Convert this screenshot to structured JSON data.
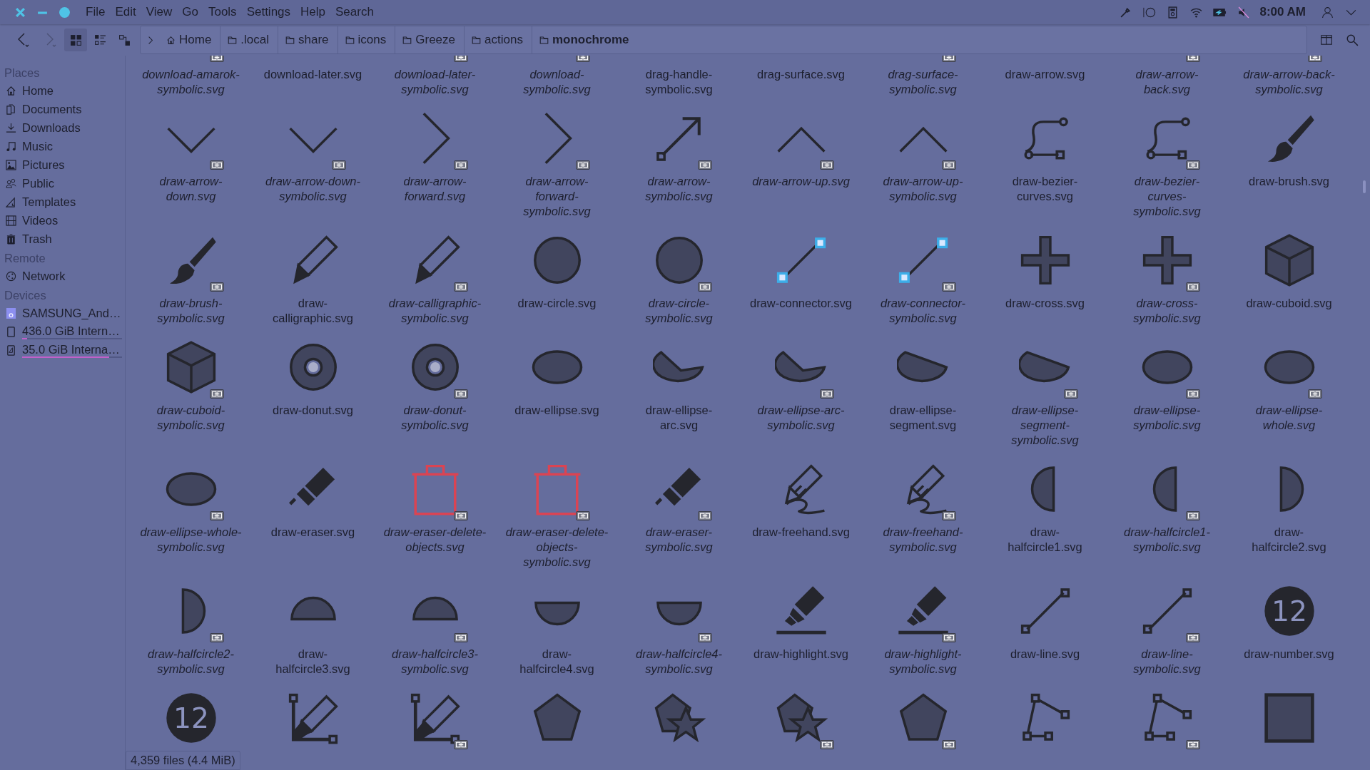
{
  "menu": [
    "File",
    "Edit",
    "View",
    "Go",
    "Tools",
    "Settings",
    "Help",
    "Search"
  ],
  "tray": {
    "clock": "8:00 AM",
    "muted": true
  },
  "navigation": [
    {
      "kind": "back",
      "disabled": false
    },
    {
      "kind": "forward",
      "disabled": true
    }
  ],
  "view_modes": [
    {
      "kind": "icons",
      "selected": true
    },
    {
      "kind": "compact",
      "selected": false
    },
    {
      "kind": "details",
      "selected": false
    }
  ],
  "breadcrumb": [
    {
      "label": "Home",
      "kind": "home",
      "current": false
    },
    {
      "label": ".local",
      "kind": "folder",
      "current": false
    },
    {
      "label": "share",
      "kind": "folder",
      "current": false
    },
    {
      "label": "icons",
      "kind": "folder",
      "current": false
    },
    {
      "label": "Greeze",
      "kind": "folder",
      "current": false
    },
    {
      "label": "actions",
      "kind": "folder",
      "current": false
    },
    {
      "label": "monochrome",
      "kind": "folder",
      "current": true
    }
  ],
  "sidebar": [
    {
      "title": "Places",
      "items": [
        {
          "label": "Home"
        },
        {
          "label": "Documents"
        },
        {
          "label": "Downloads"
        },
        {
          "label": "Music"
        },
        {
          "label": "Pictures"
        },
        {
          "label": "Public"
        },
        {
          "label": "Templates"
        },
        {
          "label": "Videos"
        },
        {
          "label": "Trash"
        }
      ]
    },
    {
      "title": "Remote",
      "items": [
        {
          "label": "Network"
        }
      ]
    },
    {
      "title": "Devices",
      "items": [
        {
          "label": "SAMSUNG_And…"
        },
        {
          "label": "436.0 GiB Intern…",
          "level": 0.05
        },
        {
          "label": "35.0 GiB Interna…",
          "level": 0.87
        }
      ]
    }
  ],
  "files": [
    {
      "label": "download-amarok-symbolic.svg",
      "link": true
    },
    {
      "label": "download-later.svg",
      "link": false
    },
    {
      "label": "download-later-symbolic.svg",
      "link": true
    },
    {
      "label": "download-symbolic.svg",
      "link": true
    },
    {
      "label": "drag-handle-symbolic.svg",
      "link": false
    },
    {
      "label": "drag-surface.svg",
      "link": false
    },
    {
      "label": "drag-surface-symbolic.svg",
      "link": true
    },
    {
      "label": "draw-arrow.svg",
      "link": false
    },
    {
      "label": "draw-arrow-back.svg",
      "link": true
    },
    {
      "label": "draw-arrow-back-symbolic.svg",
      "link": true
    },
    {
      "label": "draw-arrow-down.svg",
      "link": true
    },
    {
      "label": "draw-arrow-down-symbolic.svg",
      "link": true
    },
    {
      "label": "draw-arrow-forward.svg",
      "link": true
    },
    {
      "label": "draw-arrow-forward-symbolic.svg",
      "link": true
    },
    {
      "label": "draw-arrow-symbolic.svg",
      "link": true
    },
    {
      "label": "draw-arrow-up.svg",
      "link": true
    },
    {
      "label": "draw-arrow-up-symbolic.svg",
      "link": true
    },
    {
      "label": "draw-bezier-curves.svg",
      "link": false
    },
    {
      "label": "draw-bezier-curves-symbolic.svg",
      "link": true
    },
    {
      "label": "draw-brush.svg",
      "link": false
    },
    {
      "label": "draw-brush-symbolic.svg",
      "link": true
    },
    {
      "label": "draw-calligraphic.svg",
      "link": false
    },
    {
      "label": "draw-calligraphic-symbolic.svg",
      "link": true
    },
    {
      "label": "draw-circle.svg",
      "link": false
    },
    {
      "label": "draw-circle-symbolic.svg",
      "link": true
    },
    {
      "label": "draw-connector.svg",
      "link": false
    },
    {
      "label": "draw-connector-symbolic.svg",
      "link": true
    },
    {
      "label": "draw-cross.svg",
      "link": false
    },
    {
      "label": "draw-cross-symbolic.svg",
      "link": true
    },
    {
      "label": "draw-cuboid.svg",
      "link": false
    },
    {
      "label": "draw-cuboid-symbolic.svg",
      "link": true
    },
    {
      "label": "draw-donut.svg",
      "link": false
    },
    {
      "label": "draw-donut-symbolic.svg",
      "link": true
    },
    {
      "label": "draw-ellipse.svg",
      "link": false
    },
    {
      "label": "draw-ellipse-arc.svg",
      "link": false
    },
    {
      "label": "draw-ellipse-arc-symbolic.svg",
      "link": true
    },
    {
      "label": "draw-ellipse-segment.svg",
      "link": false
    },
    {
      "label": "draw-ellipse-segment-symbolic.svg",
      "link": true
    },
    {
      "label": "draw-ellipse-symbolic.svg",
      "link": true
    },
    {
      "label": "draw-ellipse-whole.svg",
      "link": true
    },
    {
      "label": "draw-ellipse-whole-symbolic.svg",
      "link": true
    },
    {
      "label": "draw-eraser.svg",
      "link": false
    },
    {
      "label": "draw-eraser-delete-objects.svg",
      "link": true
    },
    {
      "label": "draw-eraser-delete-objects-symbolic.svg",
      "link": true
    },
    {
      "label": "draw-eraser-symbolic.svg",
      "link": true
    },
    {
      "label": "draw-freehand.svg",
      "link": false
    },
    {
      "label": "draw-freehand-symbolic.svg",
      "link": true
    },
    {
      "label": "draw-halfcircle1.svg",
      "link": false
    },
    {
      "label": "draw-halfcircle1-symbolic.svg",
      "link": true
    },
    {
      "label": "draw-halfcircle2.svg",
      "link": false
    },
    {
      "label": "draw-halfcircle2-symbolic.svg",
      "link": true
    },
    {
      "label": "draw-halfcircle3.svg",
      "link": false
    },
    {
      "label": "draw-halfcircle3-symbolic.svg",
      "link": true
    },
    {
      "label": "draw-halfcircle4.svg",
      "link": false
    },
    {
      "label": "draw-halfcircle4-symbolic.svg",
      "link": true
    },
    {
      "label": "draw-highlight.svg",
      "link": false
    },
    {
      "label": "draw-highlight-symbolic.svg",
      "link": true
    },
    {
      "label": "draw-line.svg",
      "link": false
    },
    {
      "label": "draw-line-symbolic.svg",
      "link": true
    },
    {
      "label": "draw-number.svg",
      "link": false,
      "glyph": "12"
    },
    {
      "link": false,
      "glyph": "12"
    },
    {
      "link": false
    },
    {
      "link": true
    },
    {
      "link": false
    },
    {
      "link": false
    },
    {
      "link": true
    },
    {
      "link": true
    },
    {
      "link": false
    },
    {
      "link": true
    },
    {
      "link": false
    }
  ],
  "status_bar": "4,359 files (4.4 MiB)"
}
